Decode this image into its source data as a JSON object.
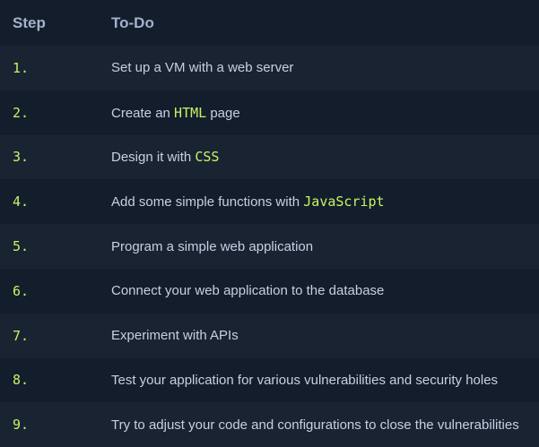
{
  "header": {
    "step": "Step",
    "todo": "To-Do"
  },
  "rows": [
    {
      "step": "1.",
      "parts": [
        {
          "text": "Set up a VM with a web server",
          "code": false
        }
      ]
    },
    {
      "step": "2.",
      "parts": [
        {
          "text": "Create an ",
          "code": false
        },
        {
          "text": "HTML",
          "code": true
        },
        {
          "text": " page",
          "code": false
        }
      ]
    },
    {
      "step": "3.",
      "parts": [
        {
          "text": "Design it with ",
          "code": false
        },
        {
          "text": "CSS",
          "code": true
        }
      ]
    },
    {
      "step": "4.",
      "parts": [
        {
          "text": "Add some simple functions with ",
          "code": false
        },
        {
          "text": "JavaScript",
          "code": true
        }
      ]
    },
    {
      "step": "5.",
      "parts": [
        {
          "text": "Program a simple web application",
          "code": false
        }
      ]
    },
    {
      "step": "6.",
      "parts": [
        {
          "text": "Connect your web application to the database",
          "code": false
        }
      ]
    },
    {
      "step": "7.",
      "parts": [
        {
          "text": "Experiment with APIs",
          "code": false
        }
      ]
    },
    {
      "step": "8.",
      "parts": [
        {
          "text": "Test your application for various vulnerabilities and security holes",
          "code": false
        }
      ]
    },
    {
      "step": "9.",
      "parts": [
        {
          "text": "Try to adjust your code and configurations to close the vulnerabilities",
          "code": false
        }
      ]
    }
  ],
  "colors": {
    "background": "#141d2b",
    "row_alt": "#1a2332",
    "accent": "#c5f467",
    "text": "#c6d0e3",
    "header_text": "#a4b1cd"
  }
}
